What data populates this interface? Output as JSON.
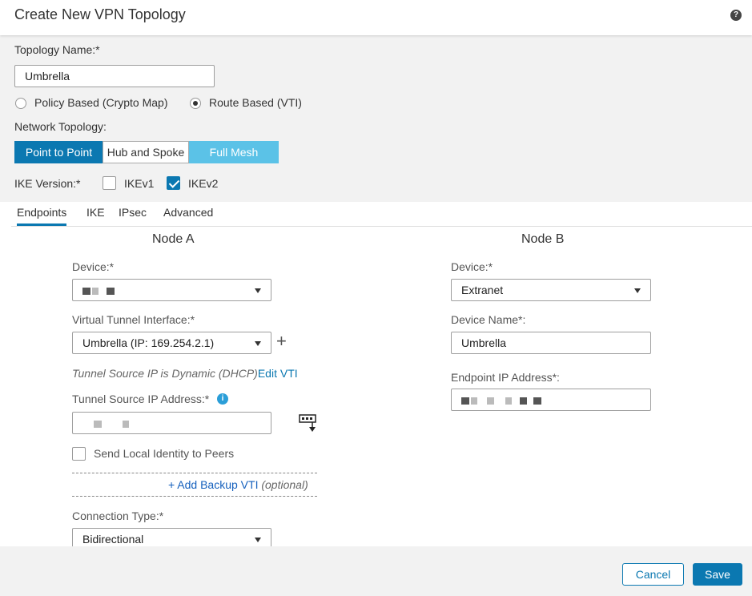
{
  "dialog": {
    "title": "Create New VPN Topology",
    "help_glyph": "?"
  },
  "topology_name": {
    "label": "Topology Name:*",
    "value": "Umbrella"
  },
  "policy_type": {
    "options": [
      {
        "label": "Policy Based (Crypto Map)",
        "selected": false
      },
      {
        "label": "Route Based (VTI)",
        "selected": true
      }
    ]
  },
  "network_topology": {
    "label": "Network Topology:",
    "options": [
      {
        "label": "Point to Point",
        "state": "selected"
      },
      {
        "label": "Hub and Spoke",
        "state": "normal"
      },
      {
        "label": "Full Mesh",
        "state": "disabled"
      }
    ]
  },
  "ike_version": {
    "label": "IKE Version:*",
    "options": [
      {
        "label": "IKEv1",
        "checked": false
      },
      {
        "label": "IKEv2",
        "checked": true
      }
    ]
  },
  "tabs": [
    {
      "label": "Endpoints",
      "active": true
    },
    {
      "label": "IKE",
      "active": false
    },
    {
      "label": "IPsec",
      "active": false
    },
    {
      "label": "Advanced",
      "active": false
    }
  ],
  "node_a": {
    "title": "Node A",
    "device_label": "Device:*",
    "vti_label": "Virtual Tunnel Interface:*",
    "vti_value": "Umbrella (IP: 169.254.2.1)",
    "dynamic_note": "Tunnel Source IP is Dynamic (DHCP)",
    "edit_vti": "Edit VTI",
    "source_ip_label": "Tunnel Source IP Address:*",
    "source_ip_info_glyph": "i",
    "send_identity_label": "Send Local Identity to Peers",
    "send_identity_checked": false,
    "add_backup_label": "+ Add Backup VTI",
    "add_backup_optional": "(optional)",
    "connection_type_label": "Connection Type:*",
    "connection_type_value": "Bidirectional"
  },
  "node_b": {
    "title": "Node B",
    "device_label": "Device:*",
    "device_value": "Extranet",
    "device_name_label": "Device Name*:",
    "device_name_value": "Umbrella",
    "endpoint_ip_label": "Endpoint IP Address*:"
  },
  "footer": {
    "cancel_label": "Cancel",
    "save_label": "Save"
  },
  "colors": {
    "primary": "#0b78b1",
    "light_blue": "#5bc2e7",
    "link_blue": "#1560bd"
  },
  "icons": [
    "help-icon",
    "radio-icon",
    "checkbox-icon",
    "plus-icon",
    "info-icon",
    "dropdown-caret-icon",
    "interface-download-icon"
  ]
}
